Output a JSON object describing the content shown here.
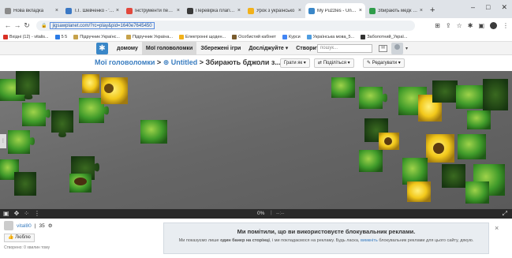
{
  "browser": {
    "tabs": [
      {
        "label": "Нова вкладка",
        "color": "#8a8a8a"
      },
      {
        "label": "Т.Г. Шевченко - 'До",
        "color": "#3b78c4"
      },
      {
        "label": "Інструменти переві",
        "color": "#e2483d"
      },
      {
        "label": "Перевірка плагіату",
        "color": "#3a3a3a"
      },
      {
        "label": "Урок з українсько",
        "color": "#f2b11a"
      },
      {
        "label": "My Puzzles - Untitle",
        "color": "#3a87c8",
        "active": true
      },
      {
        "label": "Збирають медк (бд",
        "color": "#2f9d4a"
      }
    ],
    "url": "jigsawplanet.com/?rc=play&pid=1640e7645450",
    "bookmarks": [
      {
        "label": "Вхідні (12) - vitalis...",
        "color": "#d93025"
      },
      {
        "label": "5 5",
        "color": "#2c7be5"
      },
      {
        "label": "Підручник Українс...",
        "color": "#c7a24b"
      },
      {
        "label": "Підручник Україна...",
        "color": "#c7a24b"
      },
      {
        "label": "Електронні щоден...",
        "color": "#f2b11a"
      },
      {
        "label": "Особистий кабінет",
        "color": "#7a5c2e"
      },
      {
        "label": "Курси",
        "color": "#4285f4"
      },
      {
        "label": "Українська мова_5...",
        "color": "#4f9de0"
      },
      {
        "label": "Заболотний_Украї...",
        "color": "#333333"
      }
    ]
  },
  "site": {
    "nav": [
      "домому",
      "Мої головоломки",
      "Збережені ігри",
      "Досліджуйте ▾",
      "Створити"
    ],
    "search_placeholder": "пошук..."
  },
  "puzzle": {
    "crumb_root": "Мої головоломки",
    "crumb_sep1": ">",
    "crumb_collection": "Untitled",
    "crumb_sep2": ">",
    "crumb_title": "Збирають бджоли з...",
    "btn_play": "Грати як ▾",
    "btn_share": "Поділіться ▾",
    "btn_edit": "Редагувати ▾",
    "progress": "0%",
    "progress_sep": "|",
    "timer": "--:--",
    "user": "vital80",
    "user_sep": "|",
    "user_count": "35",
    "like_label": "Люблю",
    "created": "Створено: 0 хвилин тому"
  },
  "ad": {
    "heading": "Ми помітили, що ви використовуєте блокувальник реклами.",
    "body_pre": "Ми показуємо лише",
    "body_bold": "один банер на сторінці",
    "body_mid": ", і ми покладаємося на рекламу. Будь ласка,",
    "body_link": "вимкніть",
    "body_post": "блокувальник реклами для цього сайту, дякую.",
    "close": "×"
  }
}
